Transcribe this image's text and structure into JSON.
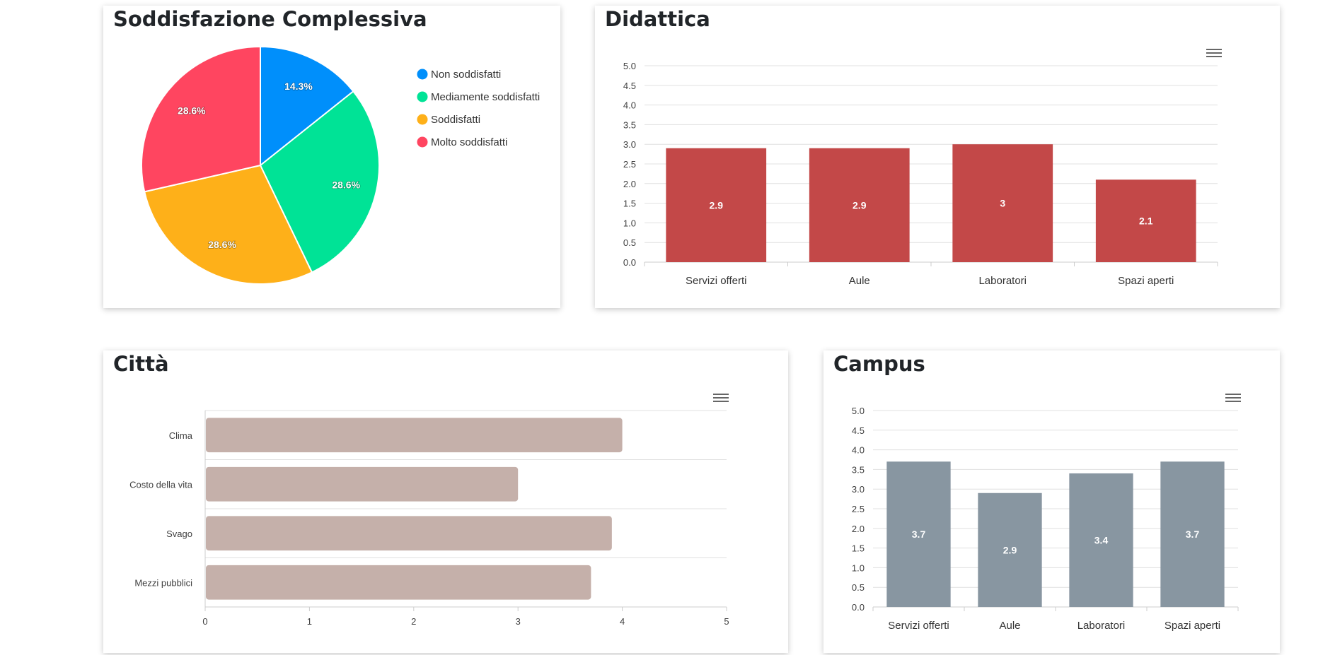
{
  "cards": {
    "overall": {
      "title": "Soddisfazione Complessiva"
    },
    "didattica": {
      "title": "Didattica"
    },
    "citta": {
      "title": "Città"
    },
    "campus": {
      "title": "Campus"
    }
  },
  "chart_data": [
    {
      "id": "overall",
      "type": "pie",
      "title": "Soddisfazione Complessiva",
      "categories": [
        "Non soddisfatti",
        "Mediamente soddisfatti",
        "Soddisfatti",
        "Molto soddisfatti"
      ],
      "values": [
        14.3,
        28.6,
        28.6,
        28.6
      ],
      "labels": [
        "14.3%",
        "28.6%",
        "28.6%",
        "28.6%"
      ],
      "colors": [
        "#008FFB",
        "#00E396",
        "#FEB019",
        "#FF4560"
      ],
      "legend": "right"
    },
    {
      "id": "didattica",
      "type": "bar",
      "title": "Didattica",
      "categories": [
        "Servizi offerti",
        "Aule",
        "Laboratori",
        "Spazi aperti"
      ],
      "values": [
        2.9,
        2.9,
        3,
        2.1
      ],
      "labels": [
        "2.9",
        "2.9",
        "3",
        "2.1"
      ],
      "ylim": [
        0,
        5
      ],
      "yticks": [
        "0.0",
        "0.5",
        "1.0",
        "1.5",
        "2.0",
        "2.5",
        "3.0",
        "3.5",
        "4.0",
        "4.5",
        "5.0"
      ],
      "color": "#C34848",
      "grid": true
    },
    {
      "id": "citta",
      "type": "bar",
      "orientation": "horizontal",
      "title": "Città",
      "categories": [
        "Clima",
        "Costo della vita",
        "Svago",
        "Mezzi pubblici"
      ],
      "values": [
        4,
        3,
        3.9,
        3.7
      ],
      "xlim": [
        0,
        5
      ],
      "xticks": [
        "0",
        "1",
        "2",
        "3",
        "4",
        "5"
      ],
      "color": "#C5B0AA",
      "grid": true
    },
    {
      "id": "campus",
      "type": "bar",
      "title": "Campus",
      "categories": [
        "Servizi offerti",
        "Aule",
        "Laboratori",
        "Spazi aperti"
      ],
      "values": [
        3.7,
        2.9,
        3.4,
        3.7
      ],
      "labels": [
        "3.7",
        "2.9",
        "3.4",
        "3.7"
      ],
      "ylim": [
        0,
        5
      ],
      "yticks": [
        "0.0",
        "0.5",
        "1.0",
        "1.5",
        "2.0",
        "2.5",
        "3.0",
        "3.5",
        "4.0",
        "4.5",
        "5.0"
      ],
      "color": "#8896A1",
      "grid": true
    }
  ]
}
